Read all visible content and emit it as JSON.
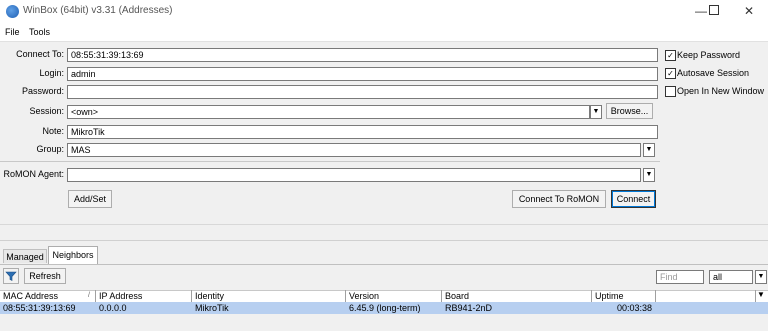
{
  "window": {
    "title": "WinBox (64bit) v3.31 (Addresses)",
    "minimize_icon": "minimize-icon",
    "maximize_icon": "maximize-icon",
    "close_icon": "close-icon"
  },
  "menu": [
    "File",
    "Tools"
  ],
  "form": {
    "connect_to": {
      "label": "Connect To:",
      "value": "08:55:31:39:13:69"
    },
    "login": {
      "label": "Login:",
      "value": "admin"
    },
    "password": {
      "label": "Password:",
      "value": ""
    },
    "session": {
      "label": "Session:",
      "value": "<own>"
    },
    "browse_label": "Browse...",
    "note": {
      "label": "Note:",
      "value": "MikroTik"
    },
    "group": {
      "label": "Group:",
      "value": "MAS"
    },
    "romon_agent": {
      "label": "RoMON Agent:",
      "value": ""
    },
    "add_set_label": "Add/Set",
    "connect_romon_label": "Connect To RoMON",
    "connect_label": "Connect"
  },
  "options": [
    {
      "label": "Keep Password",
      "checked": true
    },
    {
      "label": "Autosave Session",
      "checked": true
    },
    {
      "label": "Open In New Window",
      "checked": false
    }
  ],
  "tabs": [
    "Managed",
    "Neighbors"
  ],
  "active_tab": "Neighbors",
  "toolbar": {
    "filter_icon": "filter-icon",
    "refresh_label": "Refresh",
    "find_placeholder": "Find",
    "scope_value": "all"
  },
  "table": {
    "columns": [
      "MAC Address",
      "IP Address",
      "Identity",
      "Version",
      "Board",
      "Uptime"
    ],
    "rows": [
      {
        "mac": "08:55:31:39:13:69",
        "ip": "0.0.0.0",
        "identity": "MikroTik",
        "version": "6.45.9 (long-term)",
        "board": "RB941-2nD",
        "uptime": "00:03:38"
      }
    ]
  },
  "colors": {
    "selected_row": "#b7cff0",
    "accent": "#0078d7"
  }
}
